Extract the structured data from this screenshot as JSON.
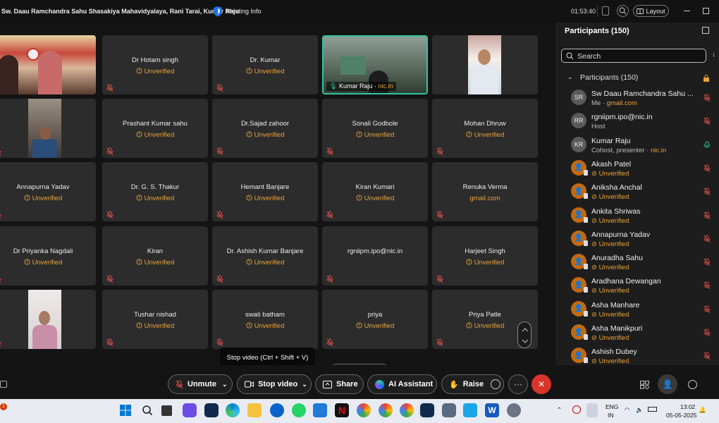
{
  "titlebar": {
    "meeting_title": "Sw. Daau Ramchandra Sahu Shasakiya Mahavidyalaya, Rani Tarai, Kumar Raju",
    "meeting_info": "Meeting Info",
    "timer": "01:53:40",
    "layout_label": "Layout"
  },
  "tiles": [
    {
      "name": "",
      "sub": "",
      "kind": "banner"
    },
    {
      "name": "Dr Hotam singh",
      "sub": "Unverified"
    },
    {
      "name": "Dr. Kumar",
      "sub": "Unverified"
    },
    {
      "name": "Kumar Raju",
      "sub": "nic.in",
      "kind": "camera"
    },
    {
      "name": "",
      "sub": "",
      "kind": "photo-man"
    },
    {
      "name": "",
      "sub": "",
      "kind": "photo-room"
    },
    {
      "name": "Prashant Kumar sahu",
      "sub": "Unverified"
    },
    {
      "name": "Dr.Sajad zahoor",
      "sub": "Unverified"
    },
    {
      "name": "Sonali Godbole",
      "sub": "Unverified"
    },
    {
      "name": "Mohan Dhruw",
      "sub": "Unverified"
    },
    {
      "name": "Annapurna Yadav",
      "sub": "Unverified"
    },
    {
      "name": "Dr. G. S. Thakur",
      "sub": "Unverified"
    },
    {
      "name": "Hemant Banjare",
      "sub": "Unverified"
    },
    {
      "name": "Kiran Kumari",
      "sub": "Unverified"
    },
    {
      "name": "Renuka Verma",
      "sub": "gmail.com"
    },
    {
      "name": "Dr Priyanka Nagdali",
      "sub": "Unverified"
    },
    {
      "name": "Kiran",
      "sub": "Unverified"
    },
    {
      "name": "Dr. Ashish Kumar Banjare",
      "sub": "Unverified"
    },
    {
      "name": "rgniipm.ipo@nic.in",
      "sub": ""
    },
    {
      "name": "Harjeet Singh",
      "sub": "Unverified"
    },
    {
      "name": "",
      "sub": "",
      "kind": "photo-woman"
    },
    {
      "name": "Tushar nishad",
      "sub": "Unverified"
    },
    {
      "name": "swati batham",
      "sub": "Unverified"
    },
    {
      "name": "priya",
      "sub": "Unverified"
    },
    {
      "name": "Priya Patle",
      "sub": "Unverified"
    }
  ],
  "panel": {
    "title": "Participants (150)",
    "search_placeholder": "Search",
    "section_label": "Participants (150)",
    "participants": [
      {
        "initials": "SR",
        "name": "Sw Daau Ramchandra Sahu ...",
        "role": "Me",
        "domain": "gmail.com",
        "guest": false
      },
      {
        "initials": "RR",
        "name": "rgniipm.ipo@nic.in",
        "role": "Host",
        "domain": "",
        "guest": false
      },
      {
        "initials": "KR",
        "name": "Kumar Raju",
        "role": "Cohost, presenter",
        "domain": "nic.in",
        "guest": false
      },
      {
        "initials": "",
        "name": "Akash Patel",
        "role": "Unverified",
        "domain": "",
        "guest": true
      },
      {
        "initials": "",
        "name": "Aniksha Anchal",
        "role": "Unverified",
        "domain": "",
        "guest": true
      },
      {
        "initials": "",
        "name": "Ankita Shriwas",
        "role": "Unverified",
        "domain": "",
        "guest": true
      },
      {
        "initials": "",
        "name": "Annapurna Yadav",
        "role": "Unverified",
        "domain": "",
        "guest": true
      },
      {
        "initials": "",
        "name": "Anuradha Sahu",
        "role": "Unverified",
        "domain": "",
        "guest": true
      },
      {
        "initials": "",
        "name": "Aradhana Dewangan",
        "role": "Unverified",
        "domain": "",
        "guest": true
      },
      {
        "initials": "",
        "name": "Asha Manhare",
        "role": "Unverified",
        "domain": "",
        "guest": true
      },
      {
        "initials": "",
        "name": "Asha Manikpuri",
        "role": "Unverified",
        "domain": "",
        "guest": true
      },
      {
        "initials": "",
        "name": "Ashish Dubey",
        "role": "Unverified",
        "domain": "",
        "guest": true
      }
    ]
  },
  "toolbar": {
    "unmute": "Unmute",
    "stop_video": "Stop video",
    "share": "Share",
    "ai_assistant": "AI Assistant",
    "raise": "Raise",
    "tooltip": "Stop video (Ctrl + Shift + V)"
  },
  "taskbar": {
    "lang_top": "ENG",
    "lang_bottom": "IN",
    "time": "13:02",
    "date": "05-05-2025"
  },
  "colors": {
    "accent_teal": "#2fc7a4",
    "warning_orange": "#e8a23a",
    "end_red": "#d9352b",
    "mute_red": "#e0524b"
  }
}
